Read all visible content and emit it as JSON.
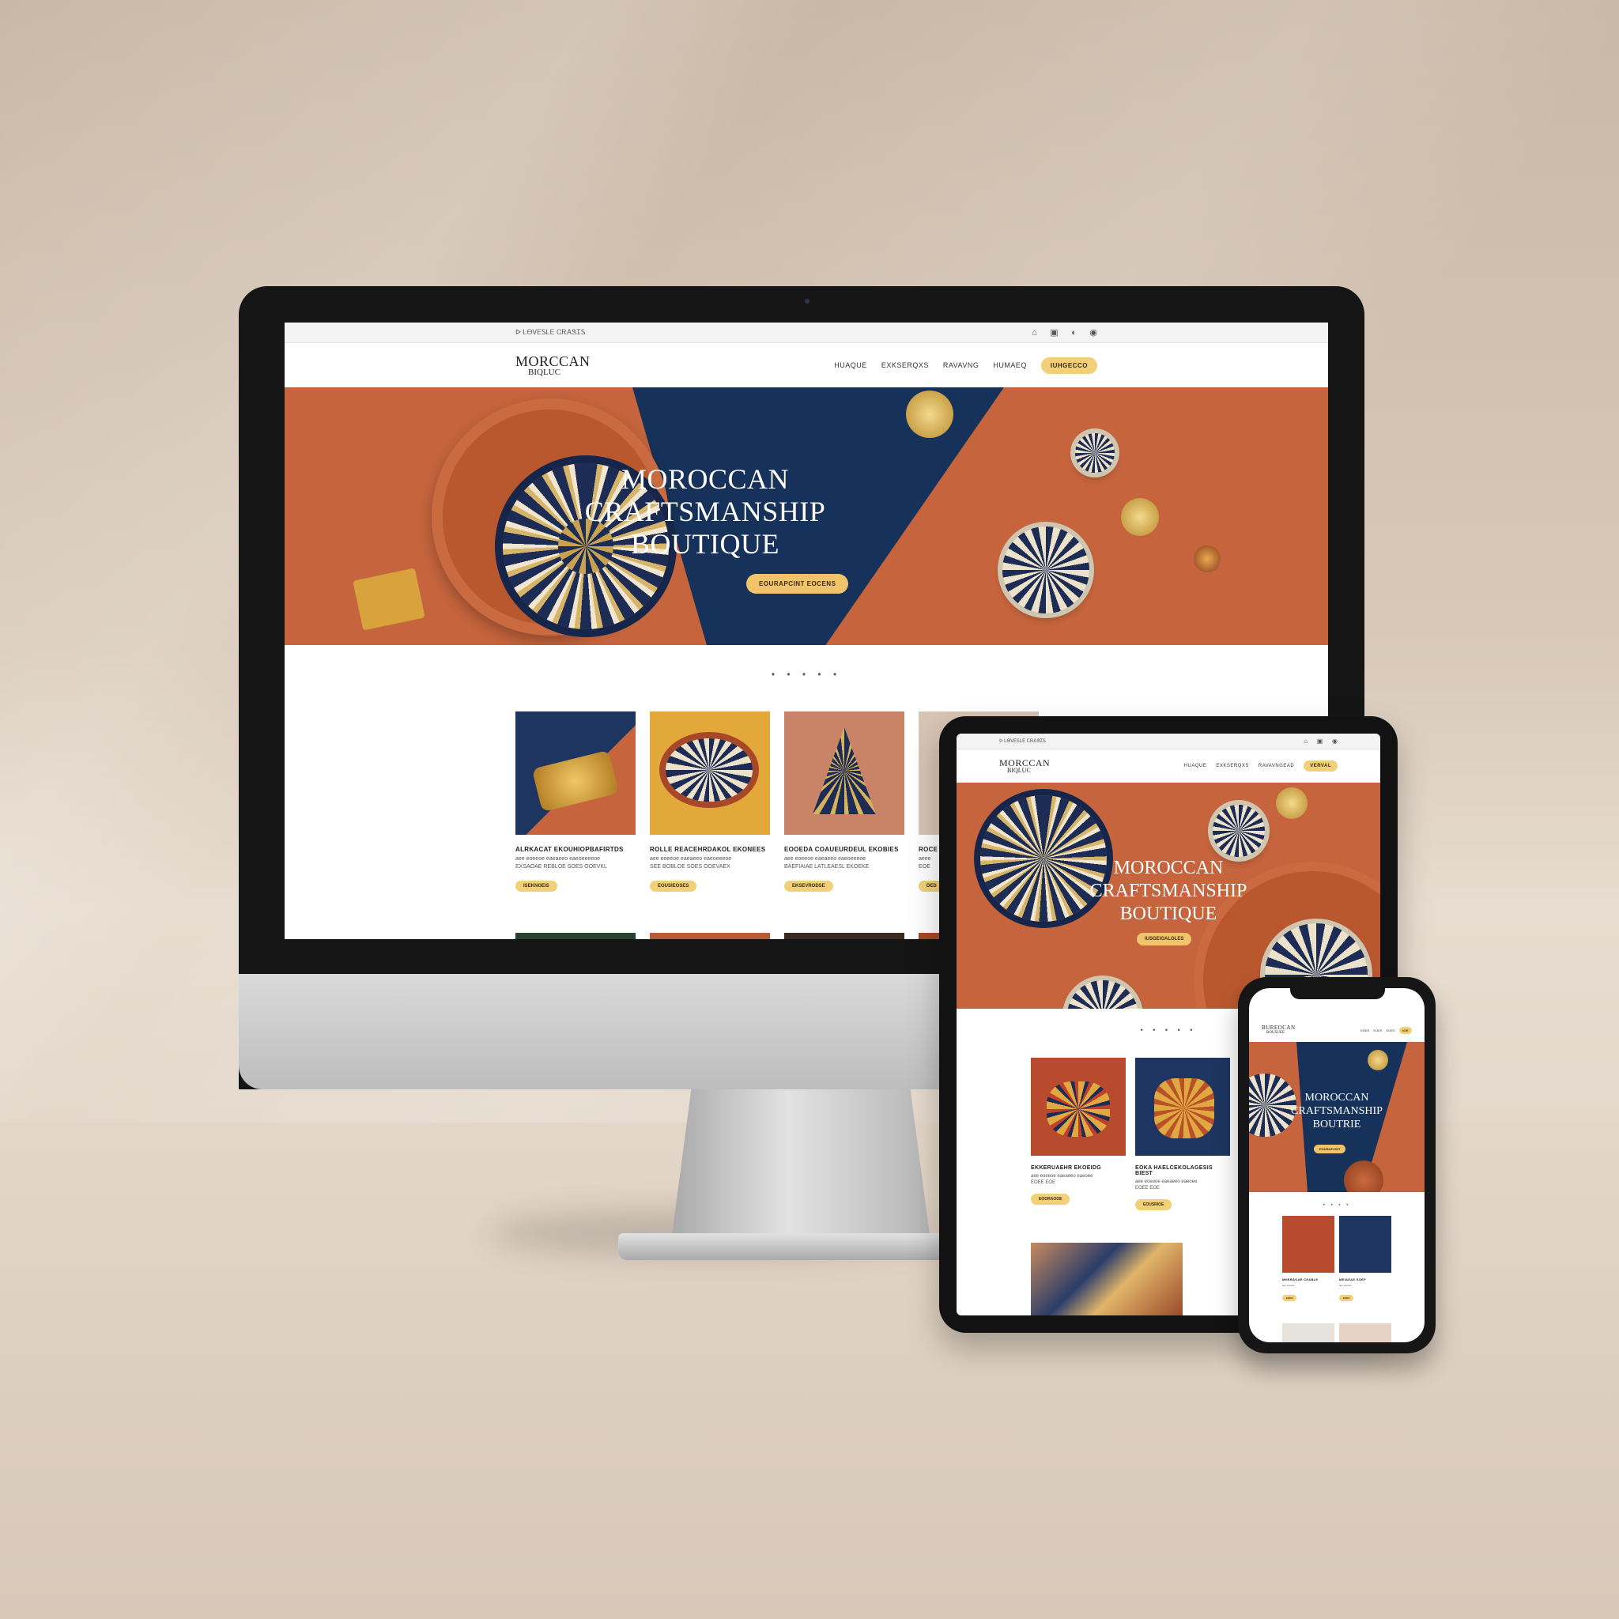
{
  "desktop": {
    "topbar_text": "ᐅ  ᏞᎾᏙᎬᏚᏞᎬ ᏟᎡᎪᏕᏆᏚ",
    "topbar_icons": [
      "⌂",
      "▣",
      "◐",
      "◉"
    ],
    "logo_line1": "MORCCAN",
    "logo_line2": "BIQLUC",
    "nav_links": [
      "HUAQUE",
      "EXKSERQXS",
      "RAVAVNG",
      "HUMAEQ"
    ],
    "nav_button": "IUHGECCO",
    "hero_title": [
      "MOROCCAN",
      "CRAFTSMANSHIP",
      "BOUTIQUE"
    ],
    "hero_button": "EOURAPCINT EOCENS",
    "dots": "• • • • •",
    "products": [
      {
        "title": "ALRKACAT EKOUHIOPBAFIRTDS",
        "desc": "aee eoeeoe eaeaeeo eaeoeeeeoe\nEXSAOAE REBLOE SOES OOEVKL",
        "button": "ISEKNOEIS"
      },
      {
        "title": "ROLLE REACEHRDAKOL EKONEES",
        "desc": "aee eoeeoe eaeaeeo eaeoeeeoe\nSEE BOBLOE SOES OOEVAEX",
        "button": "EOUSIEOSES"
      },
      {
        "title": "EOOEDA COAUEURDEUL EKOBIES",
        "desc": "aee eoeeoe eaeaeeo eaeoeeeoe\nBAEFIAIAE LATLEAESL EKOEKE",
        "button": "EKSEVRODSE"
      },
      {
        "title": "ROCE",
        "desc": "aeee\nEOE",
        "button": "DED"
      }
    ]
  },
  "tablet": {
    "topbar_text": "ᐅ  ᏞᎾᏙᎬᏚᏞᎬ ᏟᎡᎪᏕᏆᏚ",
    "topbar_icons": [
      "⌂",
      "▣",
      "◉"
    ],
    "logo_line1": "MORCCAN",
    "logo_line2": "BIQLUC",
    "nav_links": [
      "HUAQUE",
      "EXKSERQXS",
      "RAVAVNGEAD"
    ],
    "nav_button": "VERVAL",
    "hero_title": [
      "MOROCCAN",
      "CRAFTSMANSHIP",
      "BOUTIQUE"
    ],
    "hero_button": "IUSGEIOALOLES",
    "dots": "• • • • •",
    "products": [
      {
        "title": "EKKERUAEHR EKOEIDG",
        "desc": "aee eoeeoe eaeaeeo eaeoee\nEOEE EOE",
        "button": "EOORAOOE"
      },
      {
        "title": "EOKA HAELCEKOLAGESIS BIEST",
        "desc": "aee eoeeoe eaeaeeo eaeoee\nEOEE EOE",
        "button": "EOUSRIOE"
      }
    ]
  },
  "phone": {
    "logo_line1": "BUREOCAN",
    "logo_line2": "BOUSUEE",
    "nav_links": [
      "EOES",
      "EOES",
      "EOES"
    ],
    "nav_button": "IOE",
    "hero_title": [
      "MOROCCAN",
      "CRAFTSMANSHIP",
      "BOUTRIE"
    ],
    "hero_button": "EOURAPCINT",
    "dots": "• • • •",
    "products": [
      {
        "title": "MHERAOAE CEABLE",
        "desc": "aee eoeeoe",
        "button": "EOES"
      },
      {
        "title": "MEIAEAE SOEF",
        "desc": "aee eoeeoe",
        "button": "EOES"
      }
    ]
  },
  "colors": {
    "terracotta": "#c5643d",
    "navy": "#17325a",
    "gold_button": "#f2c46a",
    "backdrop": "#d9cbbb"
  }
}
